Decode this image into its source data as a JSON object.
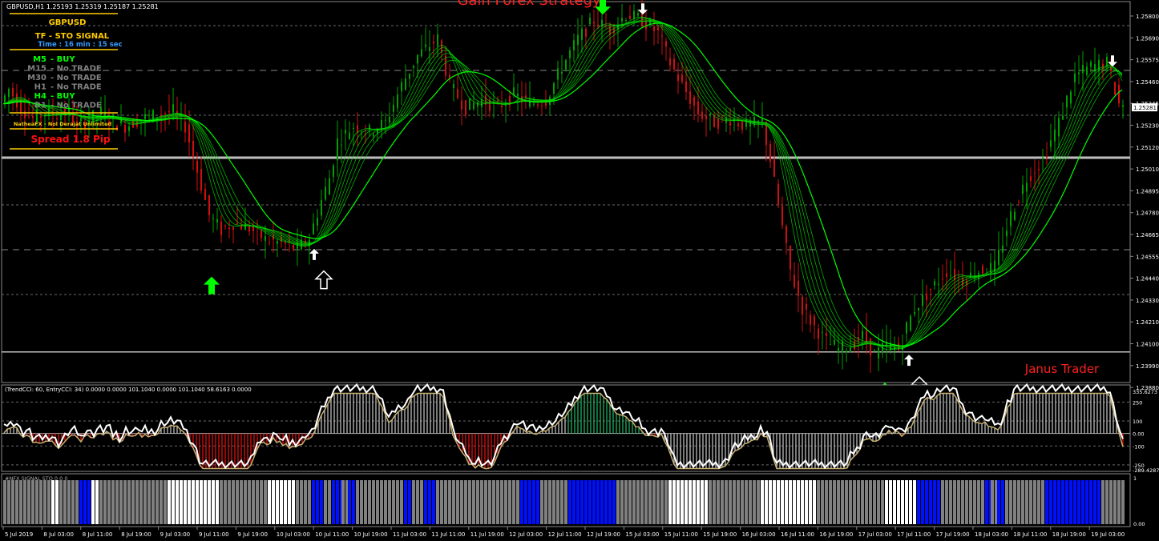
{
  "header": {
    "symbol_info": "GBPUSD,H1  1.25193 1.25319 1.25187 1.25281",
    "strategy_title": "Gain Forex Strategy"
  },
  "dashboard": {
    "pair": "GBPUSD",
    "signal_title": "TF  -  STO SIGNAL",
    "time_text": "Time :  16 min : 15 sec",
    "rows": [
      {
        "tf": "M5",
        "signal": "BUY",
        "color": "#00ff00"
      },
      {
        "tf": "M15",
        "signal": "No TRADE",
        "color": "#808080"
      },
      {
        "tf": "M30",
        "signal": "No TRADE",
        "color": "#808080"
      },
      {
        "tf": "H1",
        "signal": "No TRADE",
        "color": "#808080"
      },
      {
        "tf": "H4",
        "signal": "BUY",
        "color": "#00ff00"
      },
      {
        "tf": "D1",
        "signal": "No TRADE",
        "color": "#808080"
      }
    ],
    "brand": "NatheaFX - Nol Derajat Unlimited",
    "spread": "Spread 1.8 Pip"
  },
  "watermark": "Janus Trader",
  "price_axis": {
    "labels": [
      "1.25800",
      "1.25690",
      "1.25575",
      "1.25460",
      "1.25345",
      "1.25230",
      "1.25120",
      "1.25010",
      "1.24895",
      "1.24780",
      "1.24665",
      "1.24555",
      "1.24440",
      "1.24330",
      "1.24210",
      "1.24100",
      "1.23990",
      "1.23880"
    ],
    "current_price": "1.25281"
  },
  "cci_panel": {
    "label": "(TrendCCI: 60, EntryCCI: 34)  0.0000 0.0000 101.1040 0.0000 101.1040 58.6163 0.0000",
    "axis_labels": [
      "335.6273",
      "250",
      "100",
      "0.00",
      "-100",
      "-250",
      "-289.4287"
    ]
  },
  "sto_panel": {
    "label": "#NFX SIGNAL STO 0 0 0",
    "axis_labels": [
      "1",
      "0.00"
    ]
  },
  "time_axis": [
    "5 Jul 2019",
    "8 Jul 03:00",
    "8 Jul 11:00",
    "8 Jul 19:00",
    "9 Jul 03:00",
    "9 Jul 11:00",
    "9 Jul 19:00",
    "10 Jul 03:00",
    "10 Jul 11:00",
    "10 Jul 19:00",
    "11 Jul 03:00",
    "11 Jul 11:00",
    "11 Jul 19:00",
    "12 Jul 03:00",
    "12 Jul 11:00",
    "12 Jul 19:00",
    "15 Jul 03:00",
    "15 Jul 11:00",
    "15 Jul 19:00",
    "16 Jul 03:00",
    "16 Jul 11:00",
    "16 Jul 19:00",
    "17 Jul 03:00",
    "17 Jul 11:00",
    "17 Jul 19:00",
    "18 Jul 03:00",
    "18 Jul 11:00",
    "18 Jul 19:00",
    "19 Jul 03:00"
  ],
  "chart_data": {
    "type": "line",
    "title": "GBPUSD,H1",
    "ylim": [
      1.238,
      1.2585
    ],
    "horizontal_levels": [
      1.2501,
      1.23965
    ],
    "price_path": {
      "bars": [
        0,
        10,
        25,
        40,
        55,
        70,
        85,
        95,
        110,
        125,
        140,
        155,
        175,
        195,
        215,
        230,
        245,
        260,
        275,
        290,
        310,
        330,
        350,
        370,
        385,
        400,
        410,
        420,
        440,
        460,
        480,
        500,
        520,
        545,
        560,
        580,
        600,
        620,
        640,
        660,
        680,
        700,
        720,
        740,
        760,
        780,
        800,
        820,
        835,
        850,
        870,
        890,
        910,
        930,
        950,
        960,
        970,
        985,
        1000,
        1015,
        1030,
        1045,
        1060,
        1075,
        1090,
        1105,
        1120,
        1130,
        1140,
        1160,
        1180,
        1200,
        1220,
        1240,
        1260,
        1280,
        1300,
        1320,
        1340,
        1360,
        1380,
        1395
      ],
      "prices": [
        1.253,
        1.2538,
        1.2528,
        1.2522,
        1.2525,
        1.2524,
        1.2526,
        1.2518,
        1.2522,
        1.2525,
        1.252,
        1.2518,
        1.2522,
        1.2524,
        1.2526,
        1.2518,
        1.2494,
        1.247,
        1.2462,
        1.2466,
        1.2463,
        1.2457,
        1.2455,
        1.2452,
        1.2458,
        1.2478,
        1.249,
        1.251,
        1.2518,
        1.2515,
        1.252,
        1.254,
        1.2556,
        1.2565,
        1.254,
        1.2528,
        1.2532,
        1.2528,
        1.2535,
        1.253,
        1.2532,
        1.255,
        1.2565,
        1.2575,
        1.257,
        1.2578,
        1.2575,
        1.2568,
        1.2552,
        1.254,
        1.2525,
        1.252,
        1.2522,
        1.2518,
        1.252,
        1.25,
        1.2475,
        1.244,
        1.242,
        1.241,
        1.2402,
        1.2398,
        1.24,
        1.2405,
        1.2395,
        1.24,
        1.2398,
        1.241,
        1.242,
        1.243,
        1.244,
        1.2435,
        1.244,
        1.2442,
        1.247,
        1.249,
        1.25,
        1.252,
        1.2545,
        1.255,
        1.2552,
        1.253
      ]
    },
    "signals": [
      {
        "type": "buy-big",
        "bar": 260,
        "price": 1.2437
      },
      {
        "type": "sell-big",
        "bar": 748,
        "price": 1.2578
      },
      {
        "type": "buy-big",
        "bar": 1100,
        "price": 1.238
      },
      {
        "type": "buy-small",
        "bar": 388,
        "price": 1.2452
      },
      {
        "type": "buy-outline",
        "bar": 400,
        "price": 1.244
      },
      {
        "type": "sell-small",
        "bar": 798,
        "price": 1.2578
      },
      {
        "type": "buy-small",
        "bar": 1130,
        "price": 1.2395
      },
      {
        "type": "buy-outline",
        "bar": 1143,
        "price": 1.2383
      },
      {
        "type": "sell-small",
        "bar": 1384,
        "price": 1.255
      }
    ]
  },
  "colors": {
    "bull": "#00a000",
    "bear": "#d01010",
    "ribbon": "#00dd00",
    "grid": "#6a6a6a",
    "level": "#bfbfbf",
    "arrow_big": "#00ff00",
    "sto_gray": "#808080",
    "sto_white": "#ffffff",
    "sto_blue": "#0010ff"
  }
}
